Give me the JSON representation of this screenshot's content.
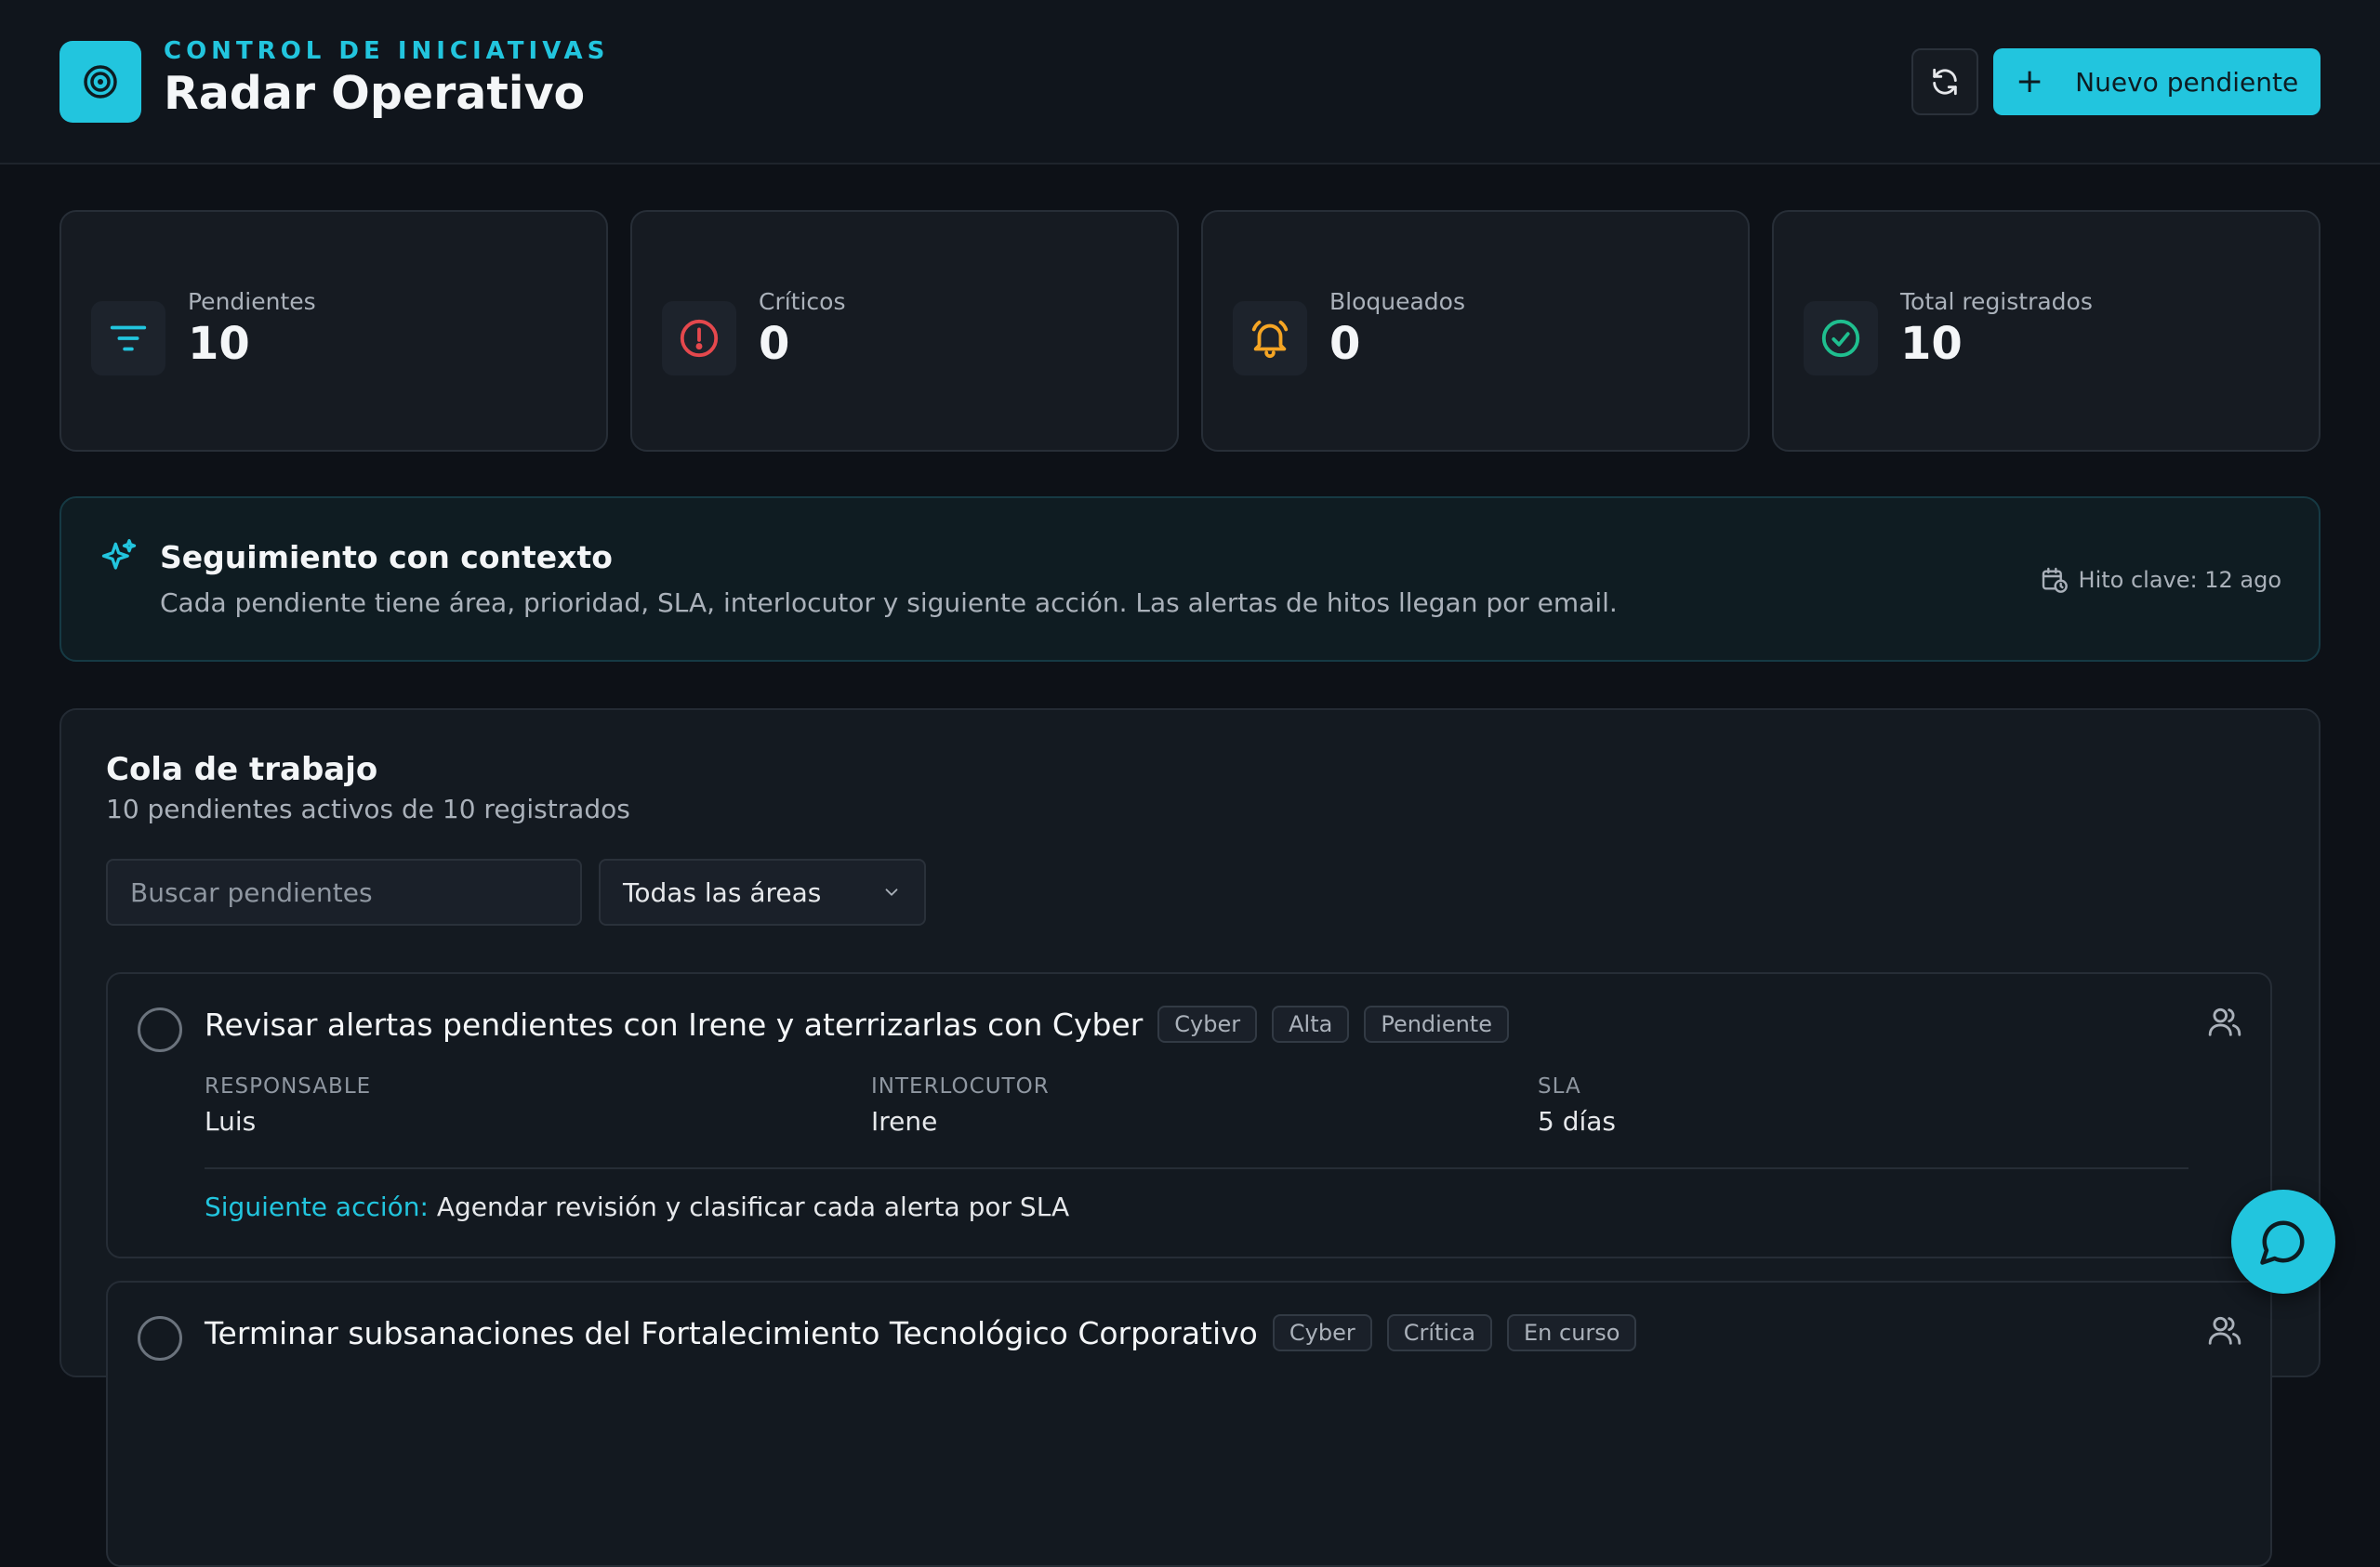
{
  "header": {
    "eyebrow": "CONTROL DE INICIATIVAS",
    "title": "Radar Operativo",
    "new_button_label": "Nuevo pendiente",
    "icons": {
      "logo": "target-icon",
      "refresh": "refresh-icon",
      "new": "plus-icon"
    }
  },
  "stats": [
    {
      "label": "Pendientes",
      "value": "10",
      "icon": "filter-icon",
      "color": "#22c5de"
    },
    {
      "label": "Críticos",
      "value": "0",
      "icon": "alert-circle-icon",
      "color": "#e5484d"
    },
    {
      "label": "Bloqueados",
      "value": "0",
      "icon": "bell-icon",
      "color": "#f5a524"
    },
    {
      "label": "Total registrados",
      "value": "10",
      "icon": "check-circle-icon",
      "color": "#1fbf8f"
    }
  ],
  "banner": {
    "title": "Seguimiento con contexto",
    "description": "Cada pendiente tiene área, prioridad, SLA, interlocutor y siguiente acción. Las alertas de hitos llegan por email.",
    "milestone": "Hito clave: 12 ago",
    "icons": {
      "spark": "sparkles-icon",
      "milestone": "calendar-clock-icon"
    }
  },
  "queue": {
    "title": "Cola de trabajo",
    "subtitle": "10 pendientes activos de 10 registrados",
    "search_placeholder": "Buscar pendientes",
    "area_filter": "Todas las áreas",
    "items": [
      {
        "title": "Revisar alertas pendientes con Irene y aterrizarlas con Cyber",
        "tags": [
          "Cyber",
          "Alta",
          "Pendiente"
        ],
        "responsable_label": "RESPONSABLE",
        "responsable": "Luis",
        "interlocutor_label": "INTERLOCUTOR",
        "interlocutor": "Irene",
        "sla_label": "SLA",
        "sla": "5 días",
        "next_label": "Siguiente acción:",
        "next_action": "Agendar revisión y clasificar cada alerta por SLA"
      },
      {
        "title": "Terminar subsanaciones del Fortalecimiento Tecnológico Corporativo",
        "tags": [
          "Cyber",
          "Crítica",
          "En curso"
        ]
      }
    ]
  },
  "accent_color": "#22c5de"
}
